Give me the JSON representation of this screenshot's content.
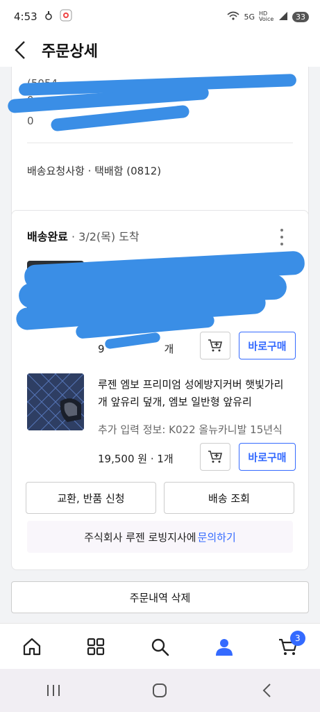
{
  "status": {
    "time": "4:53",
    "battery": "33",
    "network": "5G",
    "voice_label": "HD Voice"
  },
  "header": {
    "title": "주문상세"
  },
  "address": {
    "zip_partial": "(5054",
    "line2_partial": "0",
    "line3_partial": "0",
    "delivery_request": "배송요청사항 · 택배함 (0812)"
  },
  "shipment": {
    "status": "배송완료",
    "date": " · 3/2(목) 도착",
    "items": [
      {
        "name": "",
        "option": "",
        "price": "9",
        "qty_partial": "개",
        "buy_label": "바로구매"
      },
      {
        "name": "루젠 엠보 프리미엄 성에방지커버 햇빛가리개 앞유리 덮개, 엠보 일반형 앞유리",
        "option": "추가 입력 정보: K022 올뉴카니발 15년식",
        "price": "19,500 원 · 1개",
        "buy_label": "바로구매"
      }
    ],
    "exchange_label": "교환, 반품 신청",
    "tracking_label": "배송 조회",
    "seller_text": "주식회사 루젠 로빙지사에",
    "inquiry_link": "문의하기"
  },
  "delete_label": "주문내역 삭제",
  "nav": {
    "cart_count": "3"
  },
  "colors": {
    "accent": "#346aff",
    "redaction": "#3a8ee6"
  }
}
